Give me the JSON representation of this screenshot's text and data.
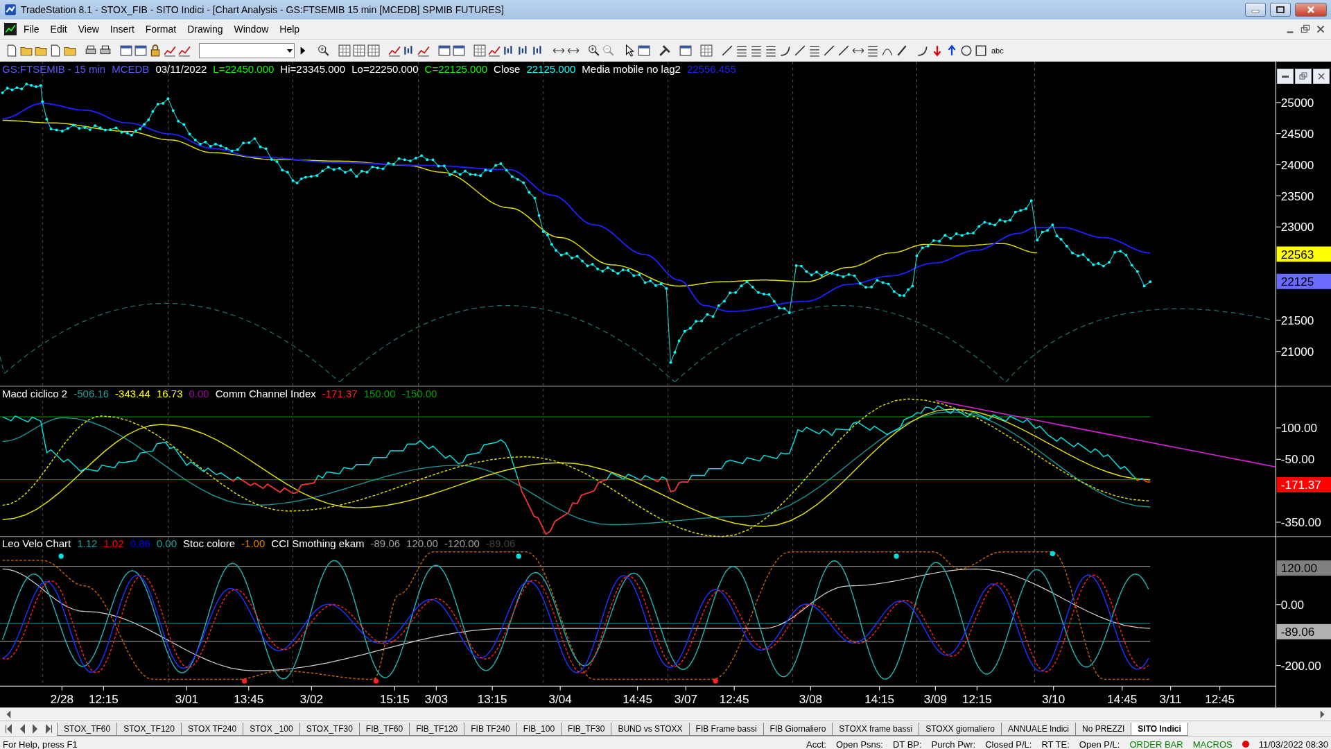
{
  "window": {
    "title": "TradeStation 8.1 - STOX_FIB - SITO Indici - [Chart Analysis - GS:FTSEMIB  15 min  [MCEDB] SPMIB FUTURES]"
  },
  "menu": [
    "File",
    "Edit",
    "View",
    "Insert",
    "Format",
    "Drawing",
    "Window",
    "Help"
  ],
  "toolbar": {
    "text_tool": "abc"
  },
  "chart": {
    "panes": [
      {
        "legend": [
          {
            "text": "GS:FTSEMIB - 15 min",
            "color": "#5a5aff"
          },
          {
            "text": "MCEDB",
            "color": "#5a5aff"
          },
          {
            "text": "03/11/2022",
            "color": "#ffffff"
          },
          {
            "text": "L=22450.000",
            "color": "#00ff00"
          },
          {
            "text": "Hi=23345.000",
            "color": "#ffffff"
          },
          {
            "text": "Lo=22250.000",
            "color": "#ffffff"
          },
          {
            "text": "C=22125.000",
            "color": "#00ff00"
          },
          {
            "text": "Close",
            "color": "#ffffff"
          },
          {
            "text": "22125.000",
            "color": "#00ffff"
          },
          {
            "text": "Media mobile no lag2",
            "color": "#ffffff"
          },
          {
            "text": "22556.455",
            "color": "#2020ff"
          }
        ],
        "yticks": [
          "25000",
          "24500",
          "24000",
          "23500",
          "23000",
          "21500",
          "21000"
        ],
        "tags": [
          {
            "text": "22563",
            "color": "#ffff00"
          },
          {
            "text": "22125",
            "color": "#6a6aff"
          }
        ]
      },
      {
        "legend": [
          {
            "text": "Macd ciclico 2",
            "color": "#ffffff"
          },
          {
            "text": "-506.16",
            "color": "#20a0a0"
          },
          {
            "text": "-343.44",
            "color": "#ffff00"
          },
          {
            "text": "16.73",
            "color": "#ffff00"
          },
          {
            "text": "0.00",
            "color": "#a000a0"
          },
          {
            "text": "Comm Channel Index",
            "color": "#ffffff"
          },
          {
            "text": "-171.37",
            "color": "#ff2020"
          },
          {
            "text": "150.00",
            "color": "#00a000"
          },
          {
            "text": "-150.00",
            "color": "#00a000"
          }
        ],
        "yticks": [
          "100.00",
          "-50.00",
          "-350.00"
        ],
        "tags": [
          {
            "text": "-171.37",
            "color": "#ff0000"
          }
        ]
      },
      {
        "legend": [
          {
            "text": "Leo Velo Chart",
            "color": "#ffffff"
          },
          {
            "text": "1.12",
            "color": "#20a0a0"
          },
          {
            "text": "1.02",
            "color": "#ff0000"
          },
          {
            "text": "0.86",
            "color": "#0000ff"
          },
          {
            "text": "0.00",
            "color": "#20a0a0"
          },
          {
            "text": "Stoc colore",
            "color": "#ffffff"
          },
          {
            "text": "-1.00",
            "color": "#e08000"
          },
          {
            "text": "CCI Smothing ekam",
            "color": "#ffffff"
          },
          {
            "text": "-89.06",
            "color": "#a0a0a0"
          },
          {
            "text": "120.00",
            "color": "#a0a0a0"
          },
          {
            "text": "-120.00",
            "color": "#a0a0a0"
          },
          {
            "text": "-89.06",
            "color": "#404040"
          }
        ],
        "yticks": [
          "0.00",
          "-200.00"
        ],
        "tags": [
          {
            "text": "120.00",
            "color": "#808080"
          },
          {
            "text": "-89.06",
            "color": "#b0b0b0"
          }
        ]
      }
    ],
    "xlabels": [
      "2/28",
      "12:15",
      "3/01",
      "13:45",
      "3/02",
      "15:15",
      "3/03",
      "13:15",
      "3/04",
      "14:45",
      "3/07",
      "12:45",
      "3/08",
      "14:15",
      "3/09",
      "12:15",
      "3/10",
      "14:45",
      "3/11",
      "12:45"
    ]
  },
  "tabs": [
    {
      "label": "STOX_TF60",
      "selected": false
    },
    {
      "label": "STOX_TF120",
      "selected": false
    },
    {
      "label": "STOX TF240",
      "selected": false
    },
    {
      "label": "STOX _100",
      "selected": false
    },
    {
      "label": "STOX_TF30",
      "selected": false
    },
    {
      "label": "FIB_TF60",
      "selected": false
    },
    {
      "label": "FIB_TF120",
      "selected": false
    },
    {
      "label": "FIB TF240",
      "selected": false
    },
    {
      "label": "FIB_100",
      "selected": false
    },
    {
      "label": "FIB_TF30",
      "selected": false
    },
    {
      "label": "BUND vs STOXX",
      "selected": false
    },
    {
      "label": "FIB Frame bassi",
      "selected": false
    },
    {
      "label": "FIB Giornaliero",
      "selected": false
    },
    {
      "label": "STOXX frame bassi",
      "selected": false
    },
    {
      "label": "STOXX giornaliero",
      "selected": false
    },
    {
      "label": "ANNUALE Indici",
      "selected": false
    },
    {
      "label": "No PREZZI",
      "selected": false
    },
    {
      "label": "SITO Indici",
      "selected": true
    }
  ],
  "status_bar": {
    "help": "For Help, press F1",
    "items": [
      {
        "text": "Acct:",
        "color": "#000000"
      },
      {
        "text": "Open Psns:",
        "color": "#000000"
      },
      {
        "text": "DT BP:",
        "color": "#000000"
      },
      {
        "text": "Purch Pwr:",
        "color": "#000000"
      },
      {
        "text": "Closed P/L:",
        "color": "#000000"
      },
      {
        "text": "RT TE:",
        "color": "#000000"
      },
      {
        "text": "Open P/L:",
        "color": "#000000"
      },
      {
        "text": "ORDER BAR",
        "color": "#008000"
      },
      {
        "text": "MACROS",
        "color": "#008000"
      }
    ],
    "datetime": "11/03/2022 08:30"
  }
}
